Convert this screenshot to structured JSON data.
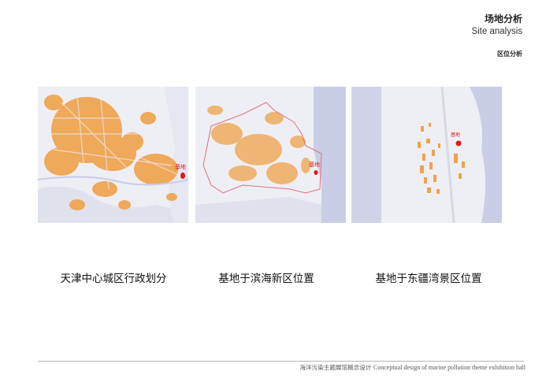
{
  "header": {
    "title_cn": "场地分析",
    "title_en": "Site analysis",
    "subtitle": "区位分析"
  },
  "maps": [
    {
      "caption": "天津中心城区行政划分",
      "marker_label": "基地"
    },
    {
      "caption": "基地于滨海新区位置",
      "marker_label": "基地"
    },
    {
      "caption": "基地于东疆湾景区位置",
      "marker_label": "基地"
    }
  ],
  "footer": {
    "cn": "海洋污染主题展馆概念设计",
    "en": "Conceptual design of marine pollution theme exhibition hall"
  },
  "colors": {
    "land": "#eeeff4",
    "water": "#c9cde6",
    "urban": "#f0a24a",
    "boundary": "#e07080",
    "marker": "#e01818"
  }
}
